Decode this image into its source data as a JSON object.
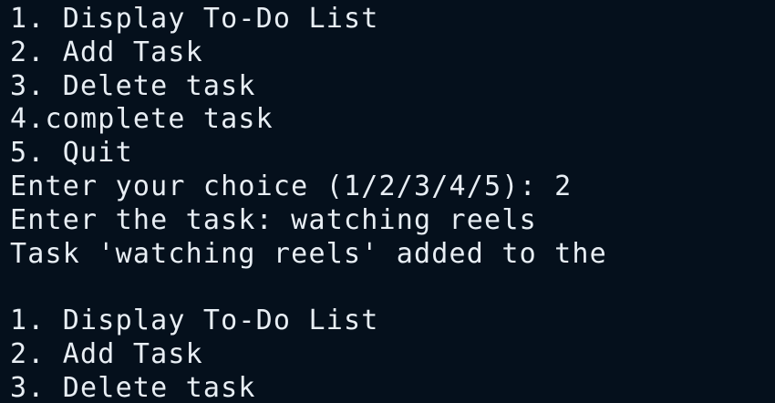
{
  "terminal": {
    "colors": {
      "background": "#05101c",
      "text": "#e8eef4"
    },
    "lines": [
      "1. Display To-Do List",
      "2. Add Task",
      "3. Delete task",
      "4.complete task",
      "5. Quit",
      "Enter your choice (1/2/3/4/5): 2",
      "Enter the task: watching reels",
      "Task 'watching reels' added to the",
      "",
      "1. Display To-Do List",
      "2. Add Task",
      "3. Delete task"
    ]
  }
}
